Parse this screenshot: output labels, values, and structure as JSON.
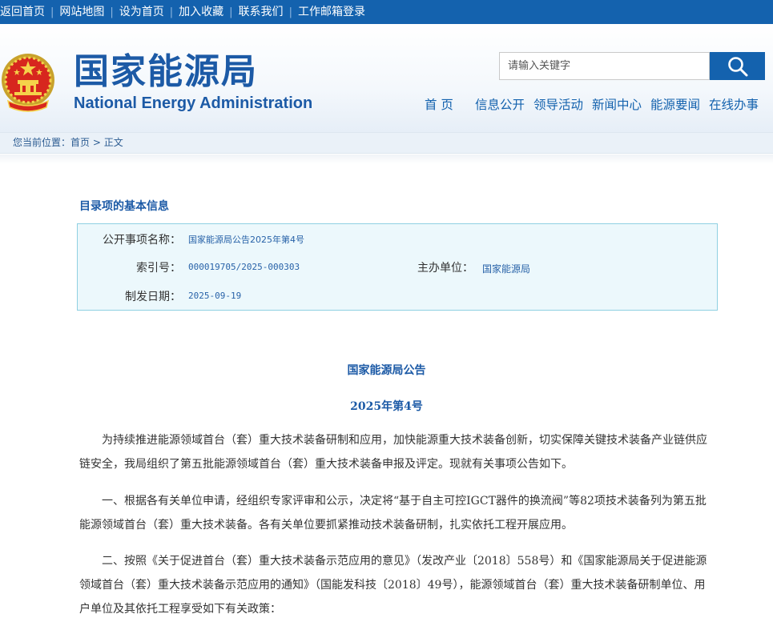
{
  "topbar": {
    "links": [
      "返回首页",
      "网站地图",
      "设为首页",
      "加入收藏",
      "联系我们",
      "工作邮箱登录"
    ]
  },
  "header": {
    "logo_cn": "国家能源局",
    "logo_en": "National Energy Administration",
    "search_placeholder": "请输入关键字",
    "nav": [
      "首 页",
      "信息公开",
      "领导活动",
      "新闻中心",
      "能源要闻",
      "在线办事"
    ]
  },
  "breadcrumb": {
    "prefix": "您当前位置：",
    "home": "首页",
    "arrow": ">",
    "current": "正文"
  },
  "info": {
    "title": "目录项的基本信息",
    "item_label": "公开事项名称：",
    "item_value": "国家能源局公告2025年第4号",
    "index_label": "索引号：",
    "index_value": "000019705/2025-000303",
    "org_label": "主办单位：",
    "org_value": "国家能源局",
    "date_label": "制发日期：",
    "date_value": "2025-09-19"
  },
  "article": {
    "title": "国家能源局公告",
    "number": "2025年第4号",
    "paragraphs": [
      "为持续推进能源领域首台（套）重大技术装备研制和应用，加快能源重大技术装备创新，切实保障关键技术装备产业链供应链安全，我局组织了第五批能源领域首台（套）重大技术装备申报及评定。现就有关事项公告如下。",
      "一、根据各有关单位申请，经组织专家评审和公示，决定将“基于自主可控IGCT器件的换流阀”等82项技术装备列为第五批能源领域首台（套）重大技术装备。各有关单位要抓紧推动技术装备研制，扎实依托工程开展应用。",
      "二、按照《关于促进首台（套）重大技术装备示范应用的意见》（发改产业〔2018〕558号）和《国家能源局关于促进能源领域首台（套）重大技术装备示范应用的通知》（国能发科技〔2018〕49号），能源领域首台（套）重大技术装备研制单位、用户单位及其依托工程享受如下有关政策："
    ]
  },
  "colors": {
    "brand_blue": "#1462ae",
    "logo_blue": "#1c5aa6",
    "info_bg": "#ecf8fc",
    "info_border": "#8fd0e2"
  },
  "icons": {
    "emblem": "national-emblem-icon",
    "search": "search-icon"
  }
}
